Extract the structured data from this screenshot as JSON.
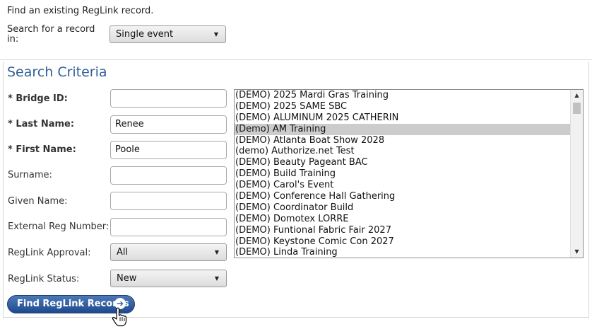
{
  "intro_text": "Find an existing RegLink record.",
  "scope": {
    "label": "Search for a record in:",
    "value": "Single event"
  },
  "legend": "Search Criteria",
  "fields": {
    "bridge_id": {
      "label": "* Bridge ID:",
      "value": ""
    },
    "last_name": {
      "label": "* Last Name:",
      "value": "Renee"
    },
    "first_name": {
      "label": "* First Name:",
      "value": "Poole"
    },
    "surname": {
      "label": "Surname:",
      "value": ""
    },
    "given_name": {
      "label": "Given Name:",
      "value": ""
    },
    "external_reg": {
      "label": "External Reg Number:",
      "value": ""
    },
    "approval": {
      "label": "RegLink Approval:",
      "value": "All"
    },
    "status": {
      "label": "RegLink Status:",
      "value": "New"
    }
  },
  "events": {
    "selected": "(Demo) AM Training",
    "items": [
      "(DEMO) 2025 Mardi Gras Training",
      "(DEMO) 2025 SAME SBC",
      "(DEMO) ALUMINUM 2025 CATHERIN",
      "(Demo) AM Training",
      "(DEMO) Atlanta Boat Show 2028",
      "(demo) Authorize.net Test",
      "(DEMO) Beauty Pageant BAC",
      "(DEMO) Build Training",
      "(DEMO) Carol's Event",
      "(DEMO) Conference Hall Gathering",
      "(DEMO) Coordinator Build",
      "(DEMO) Domotex LORRE",
      "(DEMO) Funtional Fabric Fair 2027",
      "(DEMO) Keystone Comic Con 2027",
      "(DEMO) Linda Training"
    ]
  },
  "find_button": "Find RegLink Records",
  "icons": {
    "dropdown": "chevron-down-icon",
    "go": "arrow-right-circle-icon",
    "cursor": "hand-pointer-icon"
  },
  "colors": {
    "legend": "#2f5f9a",
    "button": "#1e4a8e",
    "selected_row": "#cccccc"
  }
}
